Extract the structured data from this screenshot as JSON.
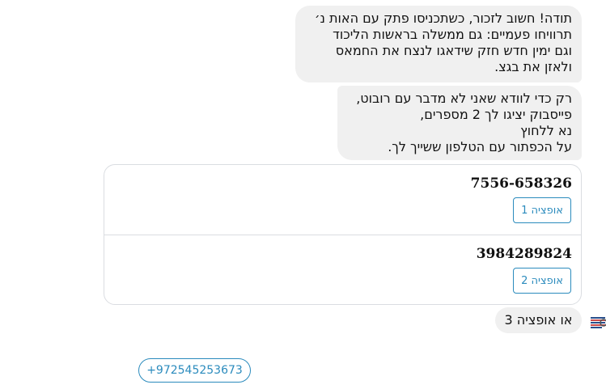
{
  "messages": {
    "bubble1_lines": [
      "תודה! חשוב לזכור, כשתכניסו פתק עם האות נ׳",
      "תרוויחו פעמיים: גם ממשלה בראשות הליכוד",
      "וגם ימין חדש חזק שידאגו לנצח את החמאס",
      "ולאזן את בגצ."
    ],
    "bubble2_lines": [
      "רק כדי לוודא שאני לא מדבר עם רובוט,",
      "פייסבוק יציגו לך 2 מספרים,",
      "נא ללחוץ",
      "על הכפתור עם הטלפון ששייך לך."
    ],
    "bubble3": "או אופציה 3"
  },
  "card": {
    "options": [
      {
        "title": "7556-658326",
        "button": "אופציה 1"
      },
      {
        "title": "3984289824",
        "button": "אופציה 2"
      }
    ]
  },
  "quick_reply": {
    "label": "+972545253673"
  },
  "colors": {
    "bubble": "#f0f0f0",
    "accent": "#2b8bbd",
    "border": "#dadde1"
  },
  "icons": {
    "avatar": "avatar-icon"
  }
}
